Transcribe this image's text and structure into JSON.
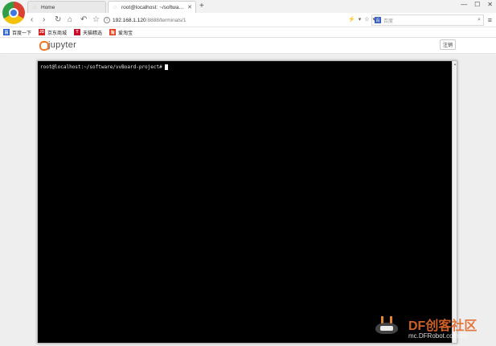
{
  "browser": {
    "tabs": [
      {
        "label": "Home",
        "active": false
      },
      {
        "label": "root@localhost: ~/software/v",
        "active": true
      }
    ],
    "new_tab": "+",
    "window_controls": {
      "minimize": "—",
      "maximize": "☐",
      "close": "✕"
    },
    "nav": {
      "back": "‹",
      "forward": "›",
      "reload": "↻",
      "home": "⌂",
      "undo": "↶",
      "star": "☆"
    },
    "address": {
      "host": "192.168.1.120",
      "path": ":8888/terminals/1"
    },
    "address_actions": {
      "lightning": "⚡",
      "dropdown": "▾",
      "favorite": "☆",
      "more": "▾"
    },
    "search": {
      "placeholder": "百度",
      "engine_letter": "百"
    },
    "menu_glyph": "≡",
    "bookmarks": [
      {
        "label": "百度一下",
        "color": "#2b5fc9",
        "letter": "百"
      },
      {
        "label": "京东商城",
        "color": "#d7201f",
        "letter": "JD"
      },
      {
        "label": "天猫精选",
        "color": "#c8102e",
        "letter": "T"
      },
      {
        "label": "爱淘宝",
        "color": "#e3421f",
        "letter": "淘"
      }
    ]
  },
  "jupyter": {
    "logo_text": "jupyter",
    "logout_label": "注销"
  },
  "terminal": {
    "prompt": "root@localhost:~/software/vvBoard-project#"
  },
  "watermark": {
    "brand": "DF创客社区",
    "site": "mc.DFRobot.com.cn"
  },
  "colors": {
    "jupyter_orange": "#f37626",
    "terminal_bg": "#000000",
    "page_bg": "#eeeeee"
  }
}
